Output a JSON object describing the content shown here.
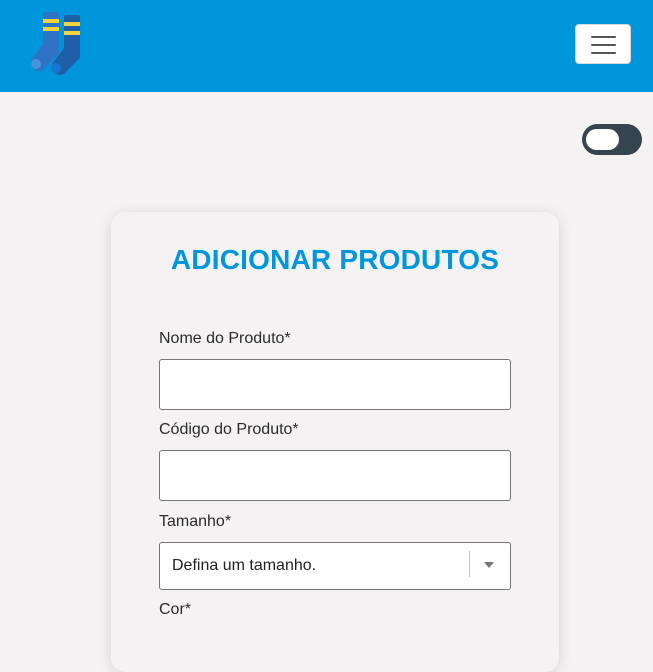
{
  "header": {
    "logo_icon": "socks-logo-icon",
    "menu_icon": "hamburger-menu-icon",
    "background_color": "#0096dc"
  },
  "theme_toggle": {
    "icon": "toggle-switch-icon",
    "state": "off"
  },
  "form": {
    "title": "ADICIONAR PRODUTOS",
    "product_name": {
      "label": "Nome do Produto*",
      "value": ""
    },
    "product_code": {
      "label": "Código do Produto*",
      "value": ""
    },
    "size": {
      "label": "Tamanho*",
      "selected": "Defina um tamanho."
    },
    "color": {
      "label": "Cor*"
    }
  }
}
